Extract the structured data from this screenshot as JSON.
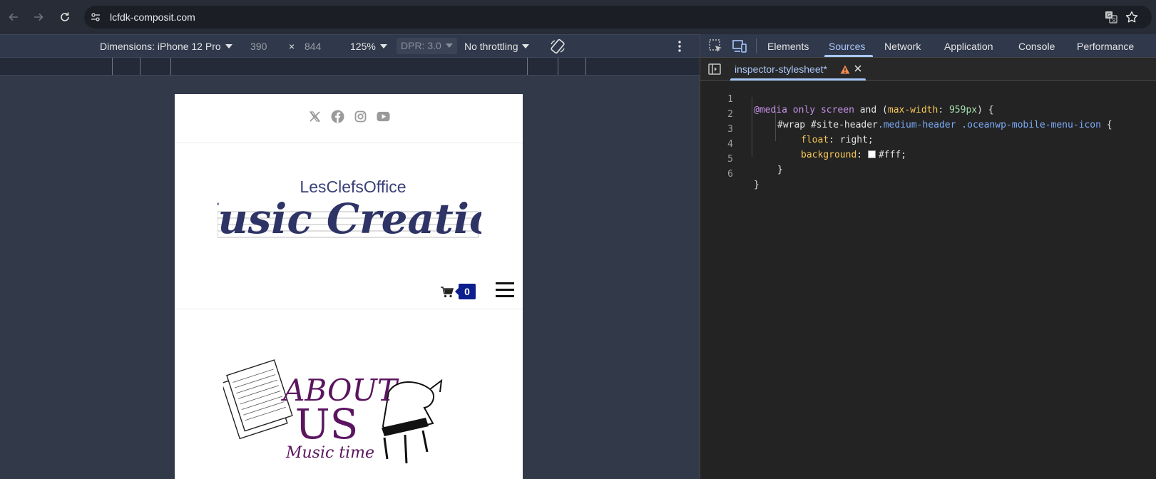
{
  "browser": {
    "url": "lcfdk-composit.com",
    "icons": [
      "back-icon",
      "forward-icon",
      "reload-icon",
      "site-info-icon",
      "translate-icon",
      "bookmark-star-icon"
    ]
  },
  "device_toolbar": {
    "dimensions_label": "Dimensions: iPhone 12 Pro",
    "width": "390",
    "times": "×",
    "height": "844",
    "zoom": "125%",
    "dpr": "DPR: 3.0",
    "throttling": "No throttling"
  },
  "page": {
    "social_icons": [
      "x-twitter-icon",
      "facebook-icon",
      "instagram-icon",
      "youtube-icon"
    ],
    "logo": {
      "line1": "LesClefsOffice",
      "line2": "Music Creation"
    },
    "cart_count": "0",
    "about": {
      "line1": "ABOUT",
      "line2": "US",
      "line3": "Music time"
    },
    "accent_color": "#2e3466",
    "about_color": "#5b1560"
  },
  "devtools": {
    "tabs": [
      "Elements",
      "Sources",
      "Network",
      "Application",
      "Console",
      "Performance"
    ],
    "active_tab": "Sources",
    "file_tab": "inspector-stylesheet*",
    "code": {
      "l1_at": "@media",
      "l1_only": "only",
      "l1_screen": "screen",
      "l1_and": "and",
      "l1_open": "(",
      "l1_prop": "max-width",
      "l1_colon": ":",
      "l1_val": "959px",
      "l1_close": ") {",
      "l2_sel1": "#wrap #site-header",
      "l2_cls1": ".medium-header",
      "l2_cls2": ".oceanwp-mobile-menu-icon",
      "l2_brace": "{",
      "l3_prop": "float",
      "l3_val": "right;",
      "l4_prop": "background",
      "l4_val": "#fff;",
      "l5": "}",
      "l6": "}",
      "colon": ":"
    }
  }
}
